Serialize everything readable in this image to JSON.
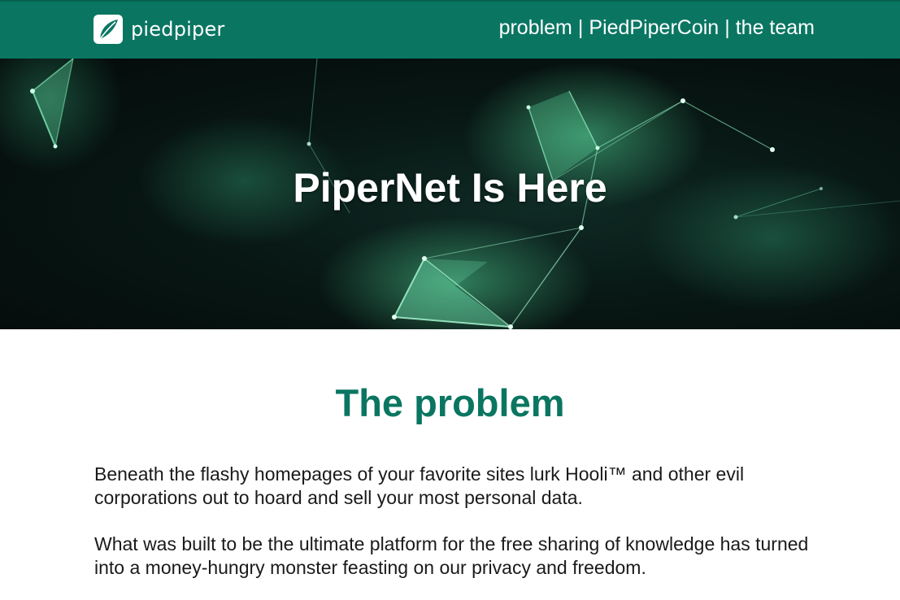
{
  "nav": {
    "logo_text": "piedpiper",
    "links": [
      "problem",
      "PiedPiperCoin",
      "the team"
    ],
    "separator": "|"
  },
  "hero": {
    "title": "PiperNet Is Here"
  },
  "problem": {
    "heading": "The problem",
    "paragraphs": [
      "Beneath the flashy homepages of your favorite sites lurk Hooli™ and other evil corporations out to hoard and sell your most personal data.",
      "What was built to be the ultimate platform for the free sharing of knowledge has turned into a money-hungry monster feasting on our privacy and freedom."
    ]
  },
  "colors": {
    "brand_green": "#0a7662",
    "hero_dark": "#081714",
    "network_green": "#5fd9a0",
    "text": "#1a1a1a"
  },
  "icons": {
    "logo": "leaf-logo-icon"
  }
}
